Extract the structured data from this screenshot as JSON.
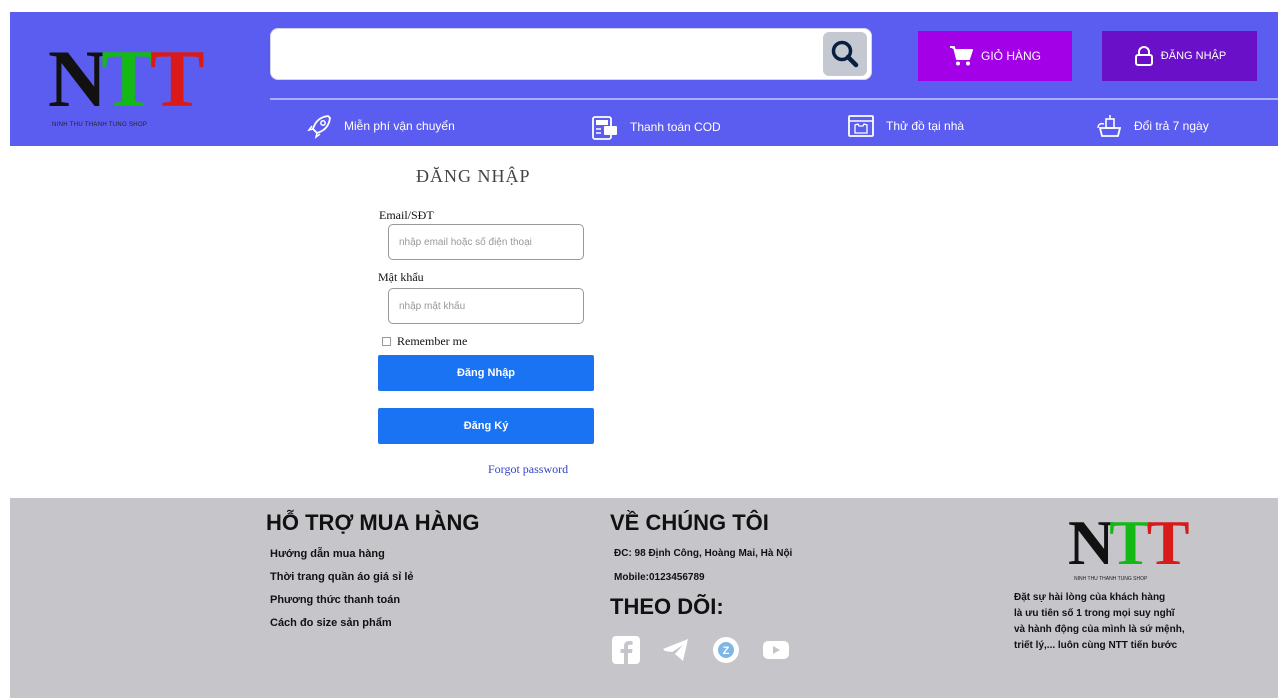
{
  "header": {
    "logo": {
      "letter1": "N",
      "letter2": "T",
      "letter3": "T",
      "tagline": "NINH THU THANH TUNG SHOP"
    },
    "search": {
      "placeholder": ""
    },
    "cart_label": "GIỎ HÀNG",
    "login_label": "ĐĂNG NHẬP",
    "features": [
      {
        "label": "Miễn phí vận chuyển",
        "icon": "rocket-icon"
      },
      {
        "label": "Thanh toán COD",
        "icon": "cod-payment-icon"
      },
      {
        "label": "Thử đồ tại nhà",
        "icon": "try-on-icon"
      },
      {
        "label": "Đổi trả 7 ngày",
        "icon": "return-icon"
      }
    ]
  },
  "login": {
    "title": "ĐĂNG NHẬP",
    "email_label": "Email/SĐT",
    "email_placeholder": "nhập email hoặc số điện thoại",
    "password_label": "Mật khẩu",
    "password_placeholder": "nhập mật khẩu",
    "remember_label": "Remember me",
    "login_button": "Đăng Nhập",
    "register_button": "Đăng Ký",
    "forgot_link": "Forgot password"
  },
  "footer": {
    "support": {
      "heading": "HỖ TRỢ MUA HÀNG",
      "items": [
        "Hướng dẫn mua hàng",
        "Thời trang quần áo giá sỉ lẻ",
        "Phương thức thanh toán",
        "Cách đo size sản phẩm"
      ]
    },
    "about": {
      "heading": "VỀ CHÚNG TÔI",
      "address": "ĐC: 98 Định Công, Hoàng Mai, Hà Nội",
      "mobile": "Mobile:0123456789",
      "follow_heading": "THEO DÕI:",
      "social": [
        "facebook-icon",
        "telegram-icon",
        "zalo-icon",
        "youtube-icon"
      ]
    },
    "brand": {
      "letter1": "N",
      "letter2": "T",
      "letter3": "T",
      "tagline": "NINH THU THANH TUNG SHOP",
      "lines": [
        "Đặt sự hài lòng của khách hàng",
        "là ưu tiên số 1 trong mọi suy nghĩ",
        "và hành động của mình là sứ mệnh,",
        "triết lý,... luôn cùng NTT tiến bước"
      ]
    }
  },
  "colors": {
    "header_bg": "#5b5df0",
    "cart_bg": "#a300e8",
    "login_bg": "#6a10c8",
    "button_blue": "#1a73f2",
    "footer_bg": "#c6c6ca"
  }
}
